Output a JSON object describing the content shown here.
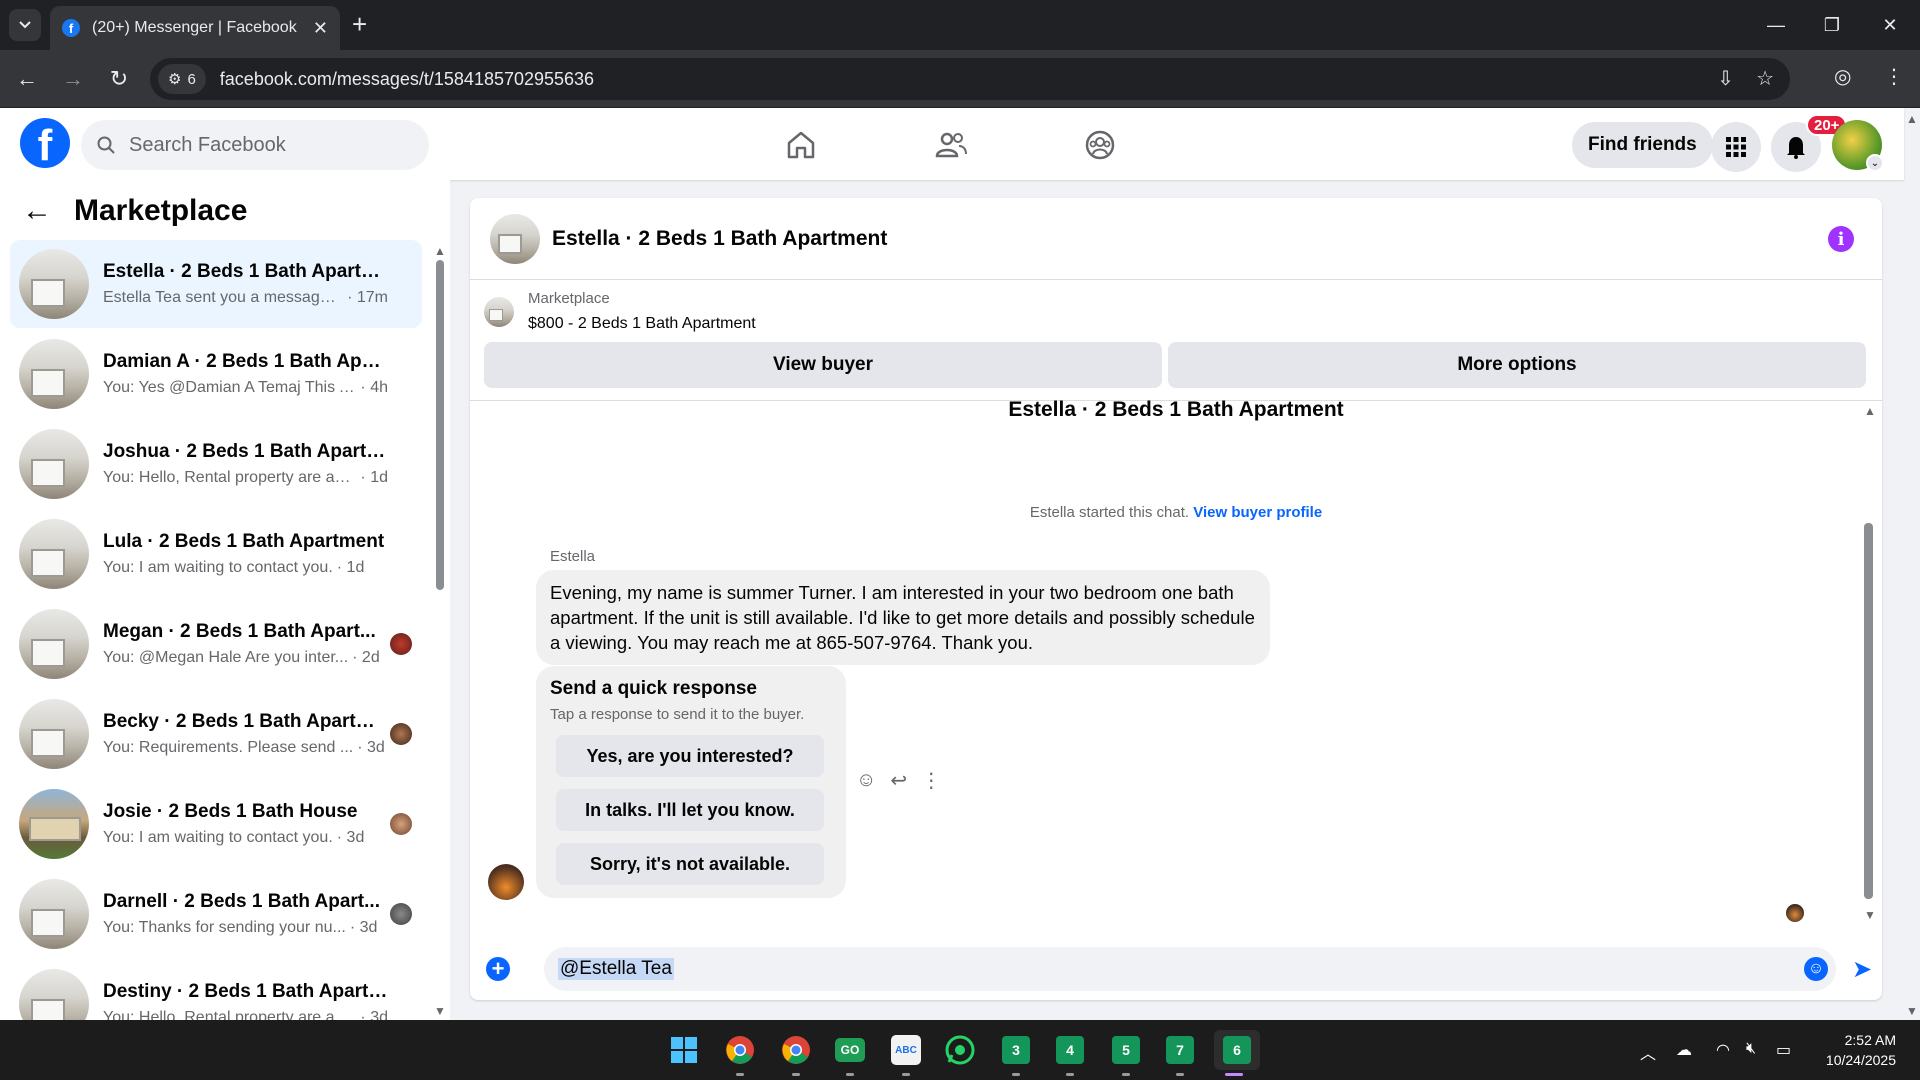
{
  "browser": {
    "tab_title": "(20+) Messenger | Facebook",
    "tab_count": "6",
    "url": "facebook.com/messages/t/1584185702955636"
  },
  "header": {
    "search_placeholder": "Search Facebook",
    "find_friends": "Find friends",
    "notifications_badge": "20+"
  },
  "sidebar": {
    "title": "Marketplace",
    "conversations": [
      {
        "name": "Estella · 2 Beds 1 Bath Apartment",
        "preview": "Estella Tea sent you a message a...",
        "time": "· 17m",
        "active": true
      },
      {
        "name": "Damian A · 2 Beds 1 Bath Apart...",
        "preview": "You: Yes @Damian A Temaj This Ap...",
        "time": "· 4h"
      },
      {
        "name": "Joshua · 2 Beds 1 Bath Apartment",
        "preview": "You: Hello, Rental property are avail...",
        "time": "· 1d"
      },
      {
        "name": "Lula · 2 Beds 1 Bath Apartment",
        "preview": "You: I am waiting to contact you.",
        "time": "· 1d"
      },
      {
        "name": "Megan · 2 Beds 1 Bath Apart...",
        "preview": "You: @Megan Hale Are you inter...",
        "time": "· 2d"
      },
      {
        "name": "Becky · 2 Beds 1 Bath Apartm...",
        "preview": "You: Requirements. Please send ...",
        "time": "· 3d"
      },
      {
        "name": "Josie · 2 Beds 1 Bath House",
        "preview": "You: I am waiting to contact you.",
        "time": "· 3d"
      },
      {
        "name": "Darnell · 2 Beds 1 Bath Apart...",
        "preview": "You: Thanks for sending your nu...",
        "time": "· 3d"
      },
      {
        "name": "Destiny · 2 Beds 1 Bath Apartment",
        "preview": "You: Hello, Rental property are avail...",
        "time": "· 3d"
      }
    ]
  },
  "chat": {
    "title": "Estella · 2 Beds 1 Bath Apartment",
    "listing_label": "Marketplace",
    "listing_price": "$800 - 2 Beds 1 Bath Apartment",
    "view_buyer": "View buyer",
    "more_options": "More options",
    "conversation_title": "Estella · 2 Beds 1 Bath Apartment",
    "started_text": "Estella started this chat.",
    "view_buyer_profile": "View buyer profile",
    "sender_name": "Estella",
    "message": "Evening, my name is summer Turner. I am interested in your two bedroom one bath apartment. If the unit is still available. I'd like to get more details and possibly schedule a viewing. You may reach me at 865-507-9764. Thank you.",
    "quick_response_title": "Send a quick response",
    "quick_response_subtitle": "Tap a response to send it to the buyer.",
    "quick_responses": [
      "Yes, are you interested?",
      "In talks. I'll let you know.",
      "Sorry, it's not available."
    ],
    "composer_text": "@Estella Tea"
  },
  "taskbar": {
    "apps": [
      "3",
      "4",
      "5",
      "7",
      "6"
    ],
    "time": "2:52 AM",
    "date": "10/24/2025"
  },
  "colors": {
    "brand_blue": "#0866ff",
    "info_purple": "#a033ff",
    "badge_red": "#e41e3f"
  }
}
